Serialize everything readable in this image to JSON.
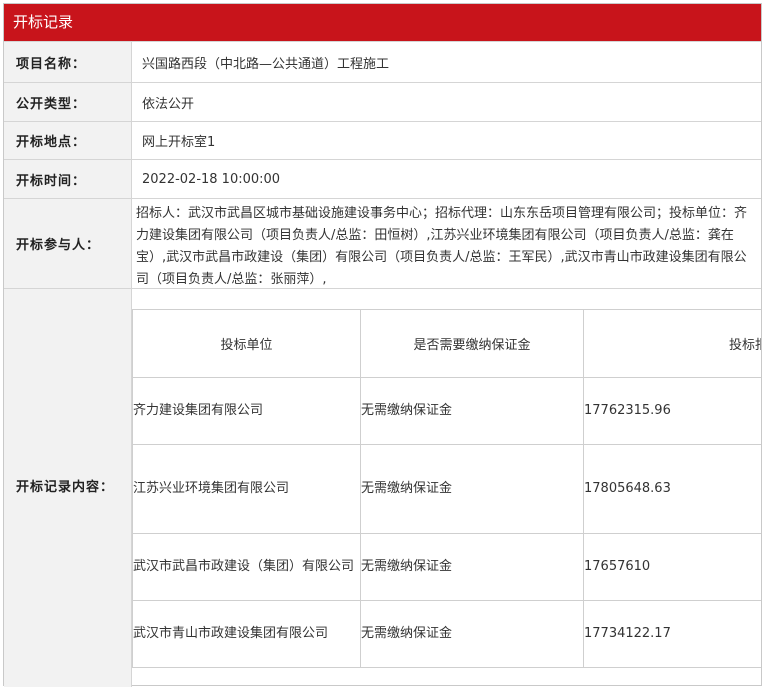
{
  "header": {
    "title": "开标记录"
  },
  "rows": {
    "project_name": {
      "label": "项目名称：",
      "value": "兴国路西段（中北路—公共通道）工程施工"
    },
    "disclosure_type": {
      "label": "公开类型：",
      "value": "依法公开"
    },
    "location": {
      "label": "开标地点：",
      "value": "网上开标室1"
    },
    "time": {
      "label": "开标时间：",
      "value": "2022-02-18 10:00:00"
    },
    "participants": {
      "label": "开标参与人：",
      "value": "招标人：武汉市武昌区城市基础设施建设事务中心；招标代理：山东东岳项目管理有限公司；投标单位：齐力建设集团有限公司（项目负责人/总监：田恒树）,江苏兴业环境集团有限公司（项目负责人/总监：龚在宝）,武汉市武昌市政建设（集团）有限公司（项目负责人/总监：王军民）,武汉市青山市政建设集团有限公司（项目负责人/总监：张丽萍）,"
    },
    "record": {
      "label": "开标记录内容："
    }
  },
  "bid_table": {
    "headers": [
      "投标单位",
      "是否需要缴纳保证金",
      "投标报价（元）"
    ],
    "rows": [
      {
        "bidder": "齐力建设集团有限公司",
        "deposit": "无需缴纳保证金",
        "price": "17762315.96"
      },
      {
        "bidder": "江苏兴业环境集团有限公司",
        "deposit": "无需缴纳保证金",
        "price": "17805648.63"
      },
      {
        "bidder": "武汉市武昌市政建设（集团）有限公司",
        "deposit": "无需缴纳保证金",
        "price": "17657610"
      },
      {
        "bidder": "武汉市青山市政建设集团有限公司",
        "deposit": "无需缴纳保证金",
        "price": "17734122.17"
      }
    ]
  }
}
